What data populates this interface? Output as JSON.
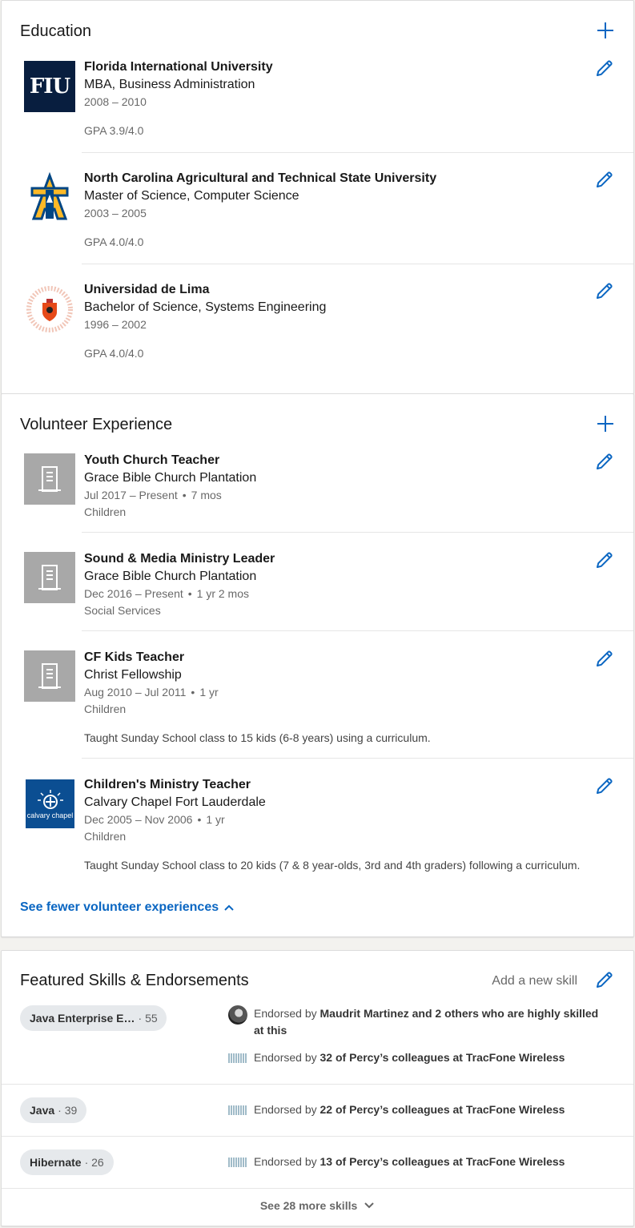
{
  "education": {
    "title": "Education",
    "entries": [
      {
        "school": "Florida International University",
        "degree": "MBA, Business Administration",
        "dates": "2008 – 2010",
        "gpa": "GPA 3.9/4.0",
        "logo_text": "FIU"
      },
      {
        "school": "North Carolina Agricultural and Technical State University",
        "degree": "Master of Science, Computer Science",
        "dates": "2003 – 2005",
        "gpa": "GPA 4.0/4.0"
      },
      {
        "school": "Universidad de Lima",
        "degree": "Bachelor of Science, Systems Engineering",
        "dates": "1996 – 2002",
        "gpa": "GPA 4.0/4.0"
      }
    ]
  },
  "volunteer": {
    "title": "Volunteer Experience",
    "entries": [
      {
        "role": "Youth Church Teacher",
        "org": "Grace Bible Church Plantation",
        "dates": "Jul 2017 – Present",
        "duration": "7 mos",
        "cause": "Children"
      },
      {
        "role": "Sound & Media Ministry Leader",
        "org": "Grace Bible Church Plantation",
        "dates": "Dec 2016 – Present",
        "duration": "1 yr 2 mos",
        "cause": "Social Services"
      },
      {
        "role": "CF Kids Teacher",
        "org": "Christ Fellowship",
        "dates": "Aug 2010 – Jul 2011",
        "duration": "1 yr",
        "cause": "Children",
        "description": "Taught Sunday School class to 15 kids (6-8 years) using a curriculum."
      },
      {
        "role": "Children's Ministry Teacher",
        "org": "Calvary Chapel Fort Lauderdale",
        "dates": "Dec 2005 – Nov 2006",
        "duration": "1 yr",
        "cause": "Children",
        "description": "Taught Sunday School class to 20 kids (7 & 8 year-olds, 3rd and 4th graders) following a curriculum.",
        "logo_text": "calvary chapel"
      }
    ],
    "see_fewer": "See fewer volunteer experiences"
  },
  "skills": {
    "title": "Featured Skills & Endorsements",
    "add_label": "Add a new skill",
    "items": [
      {
        "name": "Java Enterprise E…",
        "count": "55",
        "endorse1_prefix": "Endorsed by",
        "endorse1_bold": "Maudrit Martinez and 2 others who are highly skilled at this",
        "endorse2_prefix": "Endorsed by",
        "endorse2_bold": "32 of Percy’s colleagues at TracFone Wireless"
      },
      {
        "name": "Java",
        "count": "39",
        "endorse_prefix": "Endorsed by",
        "endorse_bold": "22 of Percy’s colleagues at TracFone Wireless"
      },
      {
        "name": "Hibernate",
        "count": "26",
        "endorse_prefix": "Endorsed by",
        "endorse_bold": "13 of Percy’s colleagues at TracFone Wireless"
      }
    ],
    "see_more": "See 28 more skills"
  },
  "colors": {
    "accent": "#0a66c2",
    "fiu_navy": "#081e3f",
    "ncat_gold": "#fdb927",
    "ncat_blue": "#004684"
  }
}
